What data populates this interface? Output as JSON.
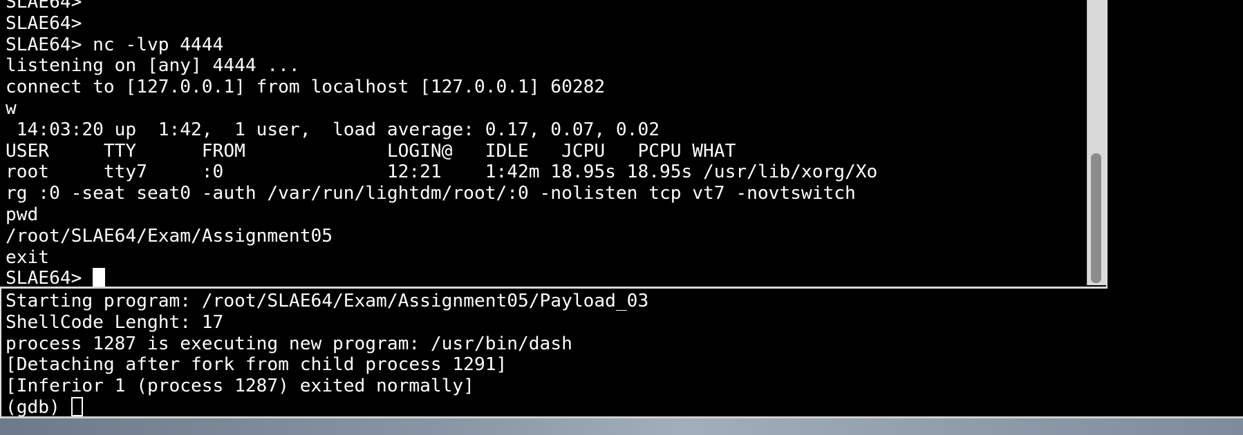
{
  "top_terminal": {
    "lines": [
      "SLAE64>",
      "SLAE64>",
      "SLAE64> nc -lvp 4444",
      "listening on [any] 4444 ...",
      "connect to [127.0.0.1] from localhost [127.0.0.1] 60282",
      "w",
      " 14:03:20 up  1:42,  1 user,  load average: 0.17, 0.07, 0.02",
      "USER     TTY      FROM             LOGIN@   IDLE   JCPU   PCPU WHAT",
      "root     tty7     :0               12:21    1:42m 18.95s 18.95s /usr/lib/xorg/Xo",
      "rg :0 -seat seat0 -auth /var/run/lightdm/root/:0 -nolisten tcp vt7 -novtswitch",
      "pwd",
      "/root/SLAE64/Exam/Assignment05",
      "exit"
    ],
    "prompt": "SLAE64> "
  },
  "bottom_terminal": {
    "lines": [
      "Starting program: /root/SLAE64/Exam/Assignment05/Payload_03",
      "ShellCode Lenght: 17",
      "process 1287 is executing new program: /usr/bin/dash",
      "[Detaching after fork from child process 1291]",
      "[Inferior 1 (process 1287) exited normally]"
    ],
    "prompt": "(gdb) "
  },
  "colors": {
    "background": "#000000",
    "foreground": "#ffffff",
    "scrollbar_track": "#d9d9d9",
    "scrollbar_thumb": "#8c8c8c"
  }
}
